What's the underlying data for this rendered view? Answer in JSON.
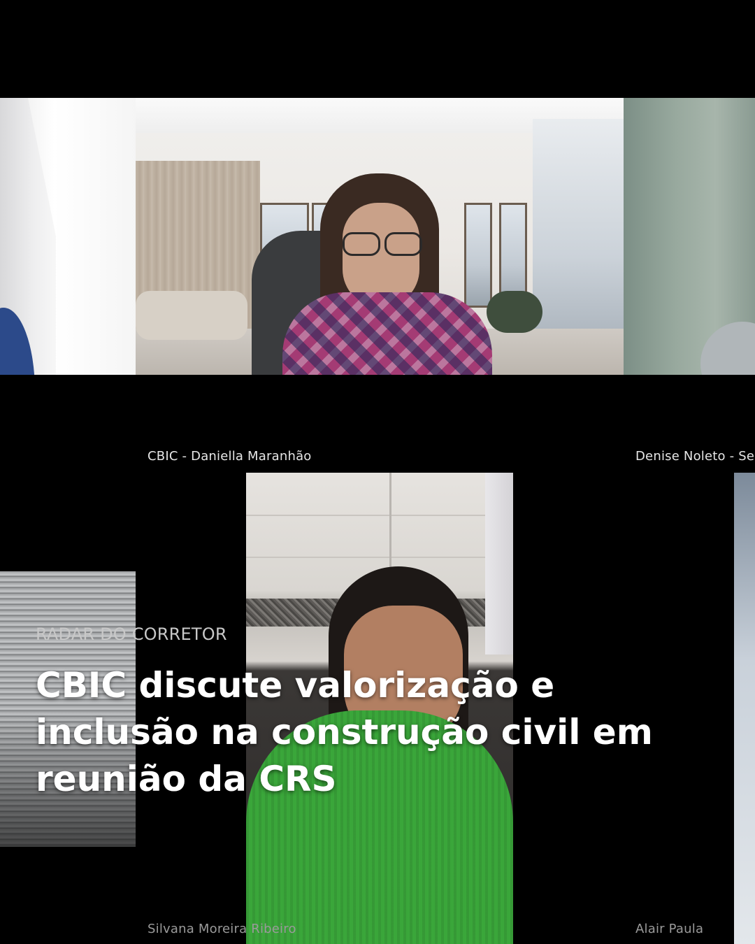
{
  "participants": {
    "top_center": {
      "name": "CBIC - Daniella Maranhão"
    },
    "top_right": {
      "name": "Denise Noleto - Se"
    },
    "bottom_center": {
      "name": "Silvana Moreira Ribeiro"
    },
    "bottom_right": {
      "name": "Alair Paula"
    }
  },
  "article": {
    "kicker": "RADAR DO CORRETOR",
    "headline": "CBIC discute valorização e inclusão na construção civil em reunião da CRS"
  },
  "colors": {
    "background": "#000000",
    "headline": "#ffffff",
    "kicker": "#c8c8c8",
    "scarf": "#a43b74",
    "sweater": "#3aa63a"
  }
}
